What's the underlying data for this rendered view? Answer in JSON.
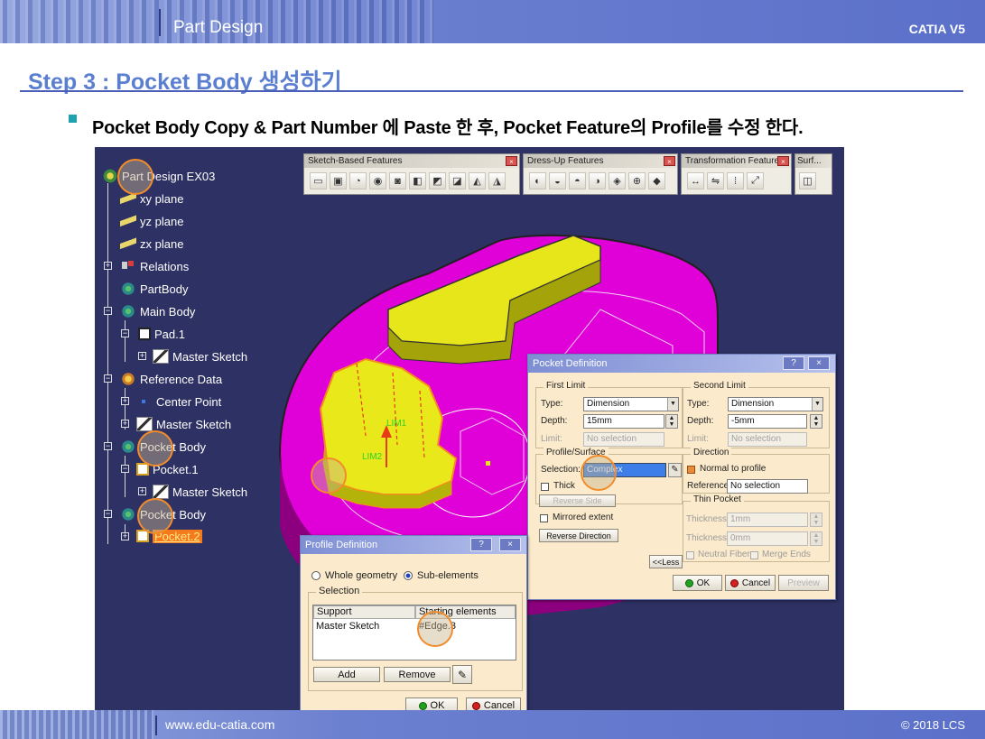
{
  "header": {
    "app_title": "Part Design",
    "brand": "CATIA V5"
  },
  "footer": {
    "site": "www.edu-catia.com",
    "copyright": "© 2018 LCS"
  },
  "step": {
    "title": "Step 3 : Pocket Body 생성하기",
    "instruction": "Pocket Body Copy & Part Number 에 Paste 한 후, Pocket Feature의 Profile를 수정 한다."
  },
  "tree": {
    "root": "Part Design EX03",
    "xy_plane": "xy plane",
    "yz_plane": "yz plane",
    "zx_plane": "zx plane",
    "relations": "Relations",
    "partbody": "PartBody",
    "main_body": "Main Body",
    "pad1": "Pad.1",
    "master_sketch_1": "Master Sketch",
    "reference_data": "Reference Data",
    "center_point": "Center Point",
    "master_sketch_2": "Master Sketch",
    "pocket_body_1": "Pocket Body",
    "pocket1": "Pocket.1",
    "master_sketch_3": "Master Sketch",
    "pocket_body_2": "Pocket Body",
    "pocket2": "Pocket.2"
  },
  "toolbars": {
    "sketch_based": "Sketch-Based Features",
    "dress_up": "Dress-Up Features",
    "transformation": "Transformation Features",
    "surf": "Surf..."
  },
  "model": {
    "lim1": "LIM1",
    "lim2": "LIM2"
  },
  "pocket_def": {
    "title": "Pocket Definition",
    "help_btn": "?",
    "close_btn": "×",
    "first_limit": {
      "legend": "First Limit",
      "type_label": "Type:",
      "type_value": "Dimension",
      "depth_label": "Depth:",
      "depth_value": "15mm",
      "limit_label": "Limit:",
      "limit_value": "No selection"
    },
    "second_limit": {
      "legend": "Second Limit",
      "type_label": "Type:",
      "type_value": "Dimension",
      "depth_label": "Depth:",
      "depth_value": "-5mm",
      "limit_label": "Limit:",
      "limit_value": "No selection"
    },
    "profile": {
      "legend": "Profile/Surface",
      "selection_label": "Selection:",
      "selection_value": "Complex",
      "thick_label": "Thick",
      "reverse_side": "Reverse Side"
    },
    "mirrored_extent": "Mirrored extent",
    "reverse_direction": "Reverse Direction",
    "direction": {
      "legend": "Direction",
      "normal_to_profile": "Normal to profile",
      "reference_label": "Reference:",
      "reference_value": "No selection"
    },
    "thin_pocket": {
      "legend": "Thin Pocket",
      "thickness1_label": "Thickness1:",
      "thickness1_value": "1mm",
      "thickness2_label": "Thickness2:",
      "thickness2_value": "0mm",
      "neutral_fiber": "Neutral Fiber",
      "merge_ends": "Merge Ends"
    },
    "less_btn": "<<Less",
    "ok": "OK",
    "cancel": "Cancel",
    "preview": "Preview"
  },
  "profile_def": {
    "title": "Profile Definition",
    "help_btn": "?",
    "close_btn": "×",
    "whole_geometry": "Whole geometry",
    "sub_elements": "Sub-elements",
    "selection_legend": "Selection",
    "col_support": "Support",
    "col_starting": "Starting elements",
    "row_support": "Master Sketch",
    "row_starting": "#Edge.3",
    "add": "Add",
    "remove": "Remove",
    "ok": "OK",
    "cancel": "Cancel"
  }
}
